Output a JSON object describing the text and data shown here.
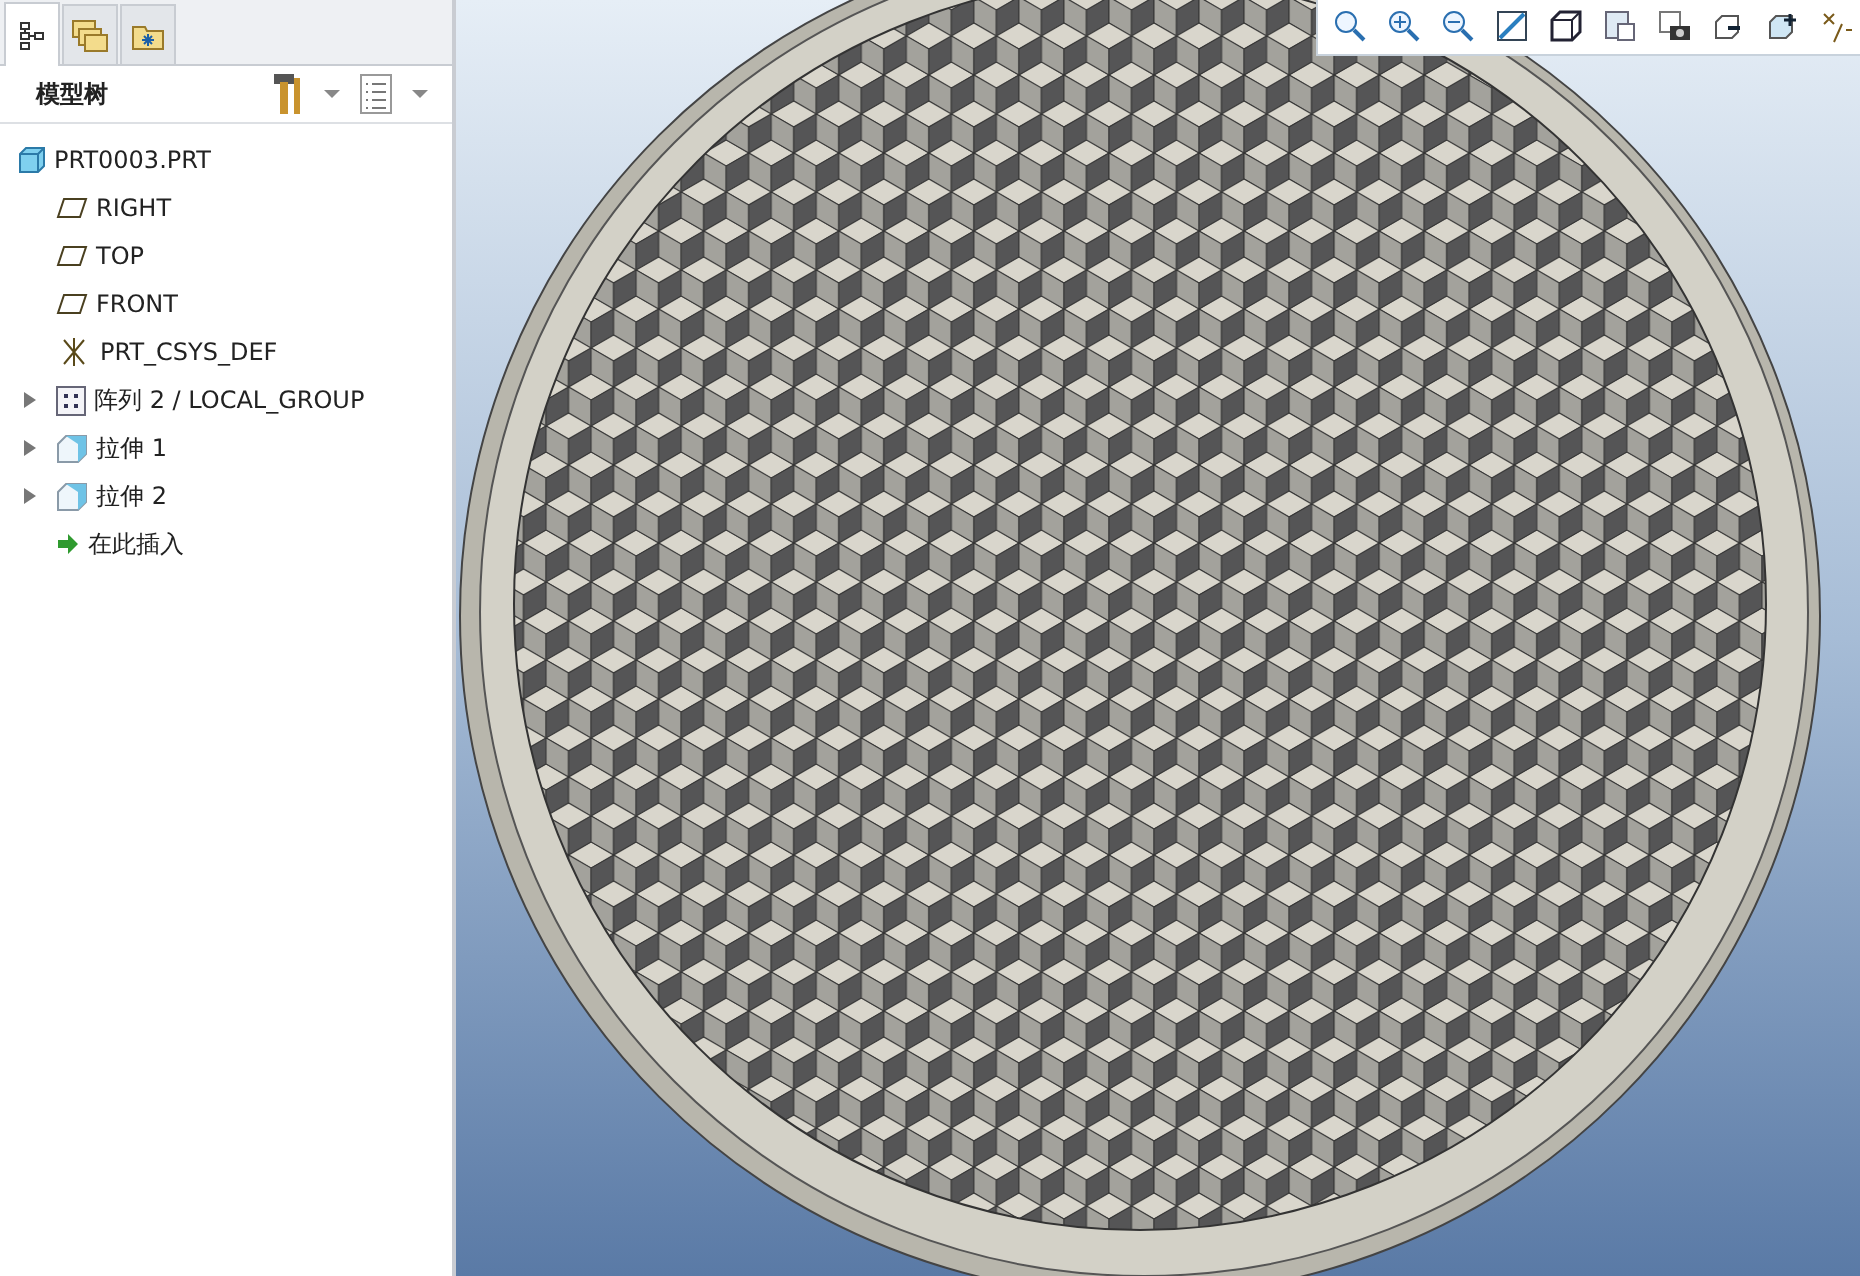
{
  "panel_tabs": [
    {
      "kind": "tree",
      "selected": true
    },
    {
      "kind": "folders",
      "selected": false
    },
    {
      "kind": "favorites",
      "selected": false
    }
  ],
  "model_tree": {
    "title": "模型树",
    "items": [
      {
        "kind": "part",
        "label": "PRT0003.PRT"
      },
      {
        "kind": "plane",
        "label": "RIGHT"
      },
      {
        "kind": "plane",
        "label": "TOP"
      },
      {
        "kind": "plane",
        "label": "FRONT"
      },
      {
        "kind": "csys",
        "label": "PRT_CSYS_DEF"
      },
      {
        "kind": "pattern",
        "label": "阵列 2 / LOCAL_GROUP",
        "expanded": false
      },
      {
        "kind": "extrude",
        "label": "拉伸 1",
        "expanded": false
      },
      {
        "kind": "extrude",
        "label": "拉伸 2",
        "expanded": false
      },
      {
        "kind": "insert",
        "label": "在此插入"
      }
    ]
  }
}
